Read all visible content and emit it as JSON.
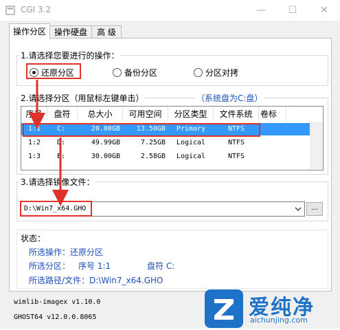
{
  "window": {
    "title": "CGI 3.2",
    "minimize": "—",
    "maximize": "☐",
    "close": "✕"
  },
  "tabs": [
    {
      "label": "操作分区",
      "active": true
    },
    {
      "label": "操作硬盘",
      "active": false
    },
    {
      "label": "高 级",
      "active": false
    }
  ],
  "operation": {
    "title": "1.请选择您要进行的操作：",
    "options": [
      {
        "label": "还原分区",
        "selected": true
      },
      {
        "label": "备份分区",
        "selected": false
      },
      {
        "label": "分区对拷",
        "selected": false
      }
    ]
  },
  "partition": {
    "title": "2.请选择分区（用鼠标左键单击）",
    "system_disk": "（系统盘为C:盘）",
    "columns": [
      "序号",
      "盘符",
      "总大小",
      "可用空间",
      "分区类型",
      "文件系统",
      "卷标"
    ],
    "rows": [
      {
        "index": "1:1",
        "letter": "C:",
        "total": "20.00GB",
        "free": "13.50GB",
        "type": "Primary",
        "fs": "NTFS",
        "label": "",
        "selected": true
      },
      {
        "index": "1:2",
        "letter": "D:",
        "total": "49.99GB",
        "free": "7.25GB",
        "type": "Logical",
        "fs": "NTFS",
        "label": "",
        "selected": false
      },
      {
        "index": "1:3",
        "letter": "E:",
        "total": "30.00GB",
        "free": "2.58GB",
        "type": "Logical",
        "fs": "NTFS",
        "label": "",
        "selected": false
      }
    ]
  },
  "image": {
    "title": "3.请选择镜像文件：",
    "value": "D:\\Win7_x64.GHO",
    "browse_label": "..."
  },
  "status": {
    "title": "状态：",
    "operation": "所选操作：还原分区",
    "partition_label": "所选分区：",
    "partition_value": "序号 1:1",
    "letter_value": "盘符 C:",
    "path": "所选路径/文件：D:\\Win7_x64.GHO"
  },
  "footer": {
    "line1": "wimlib-imagex v1.10.0",
    "line2": "GHOST64 v12.0.0.8065"
  },
  "watermark": {
    "name": "爱纯净",
    "site": "aichunjing.com"
  },
  "colors": {
    "selection": "#3399ff",
    "highlight_box": "#e0302a",
    "status_text": "#1b4fb8",
    "logo": "#1e73c9"
  }
}
